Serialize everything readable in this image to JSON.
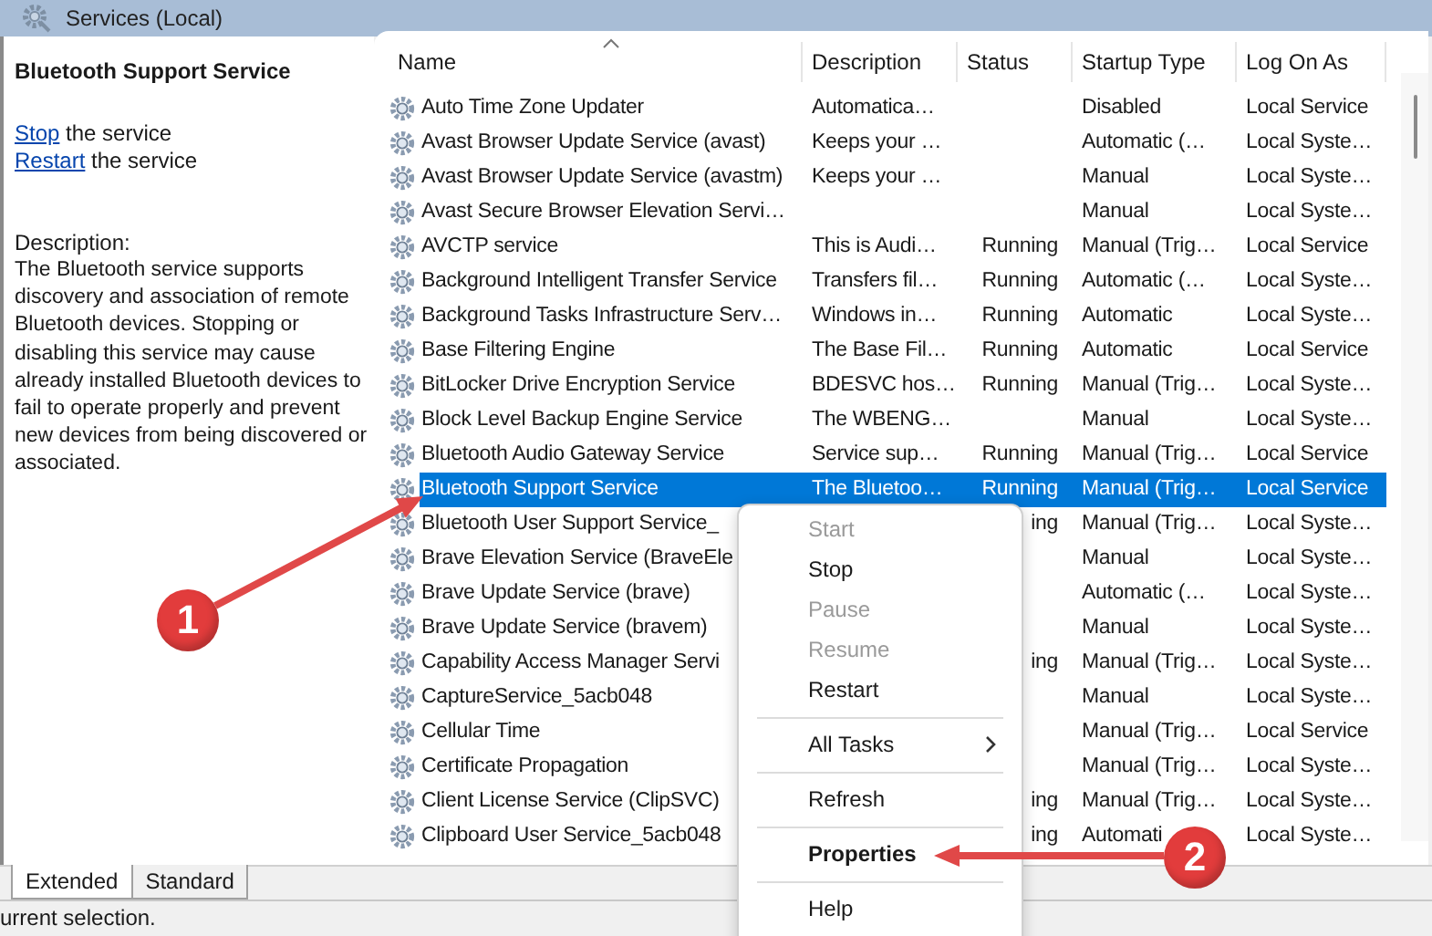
{
  "window": {
    "title": "Services (Local)"
  },
  "details": {
    "title": "Bluetooth Support Service",
    "actions": [
      {
        "link": "Stop",
        "text": "the service"
      },
      {
        "link": "Restart",
        "text": "the service"
      }
    ],
    "description_label": "Description:",
    "description": "The Bluetooth service supports discovery and association of remote Bluetooth devices.  Stopping or disabling this service may cause already installed Bluetooth devices to fail to operate properly and prevent new devices from being discovered or associated."
  },
  "table": {
    "columns": [
      "Name",
      "Description",
      "Status",
      "Startup Type",
      "Log On As"
    ],
    "rows": [
      {
        "name": "Auto Time Zone Updater",
        "description": "Automatica…",
        "startup_type": "Disabled",
        "log_on_as": "Local Service",
        "selected": false
      },
      {
        "name": "Avast Browser Update Service (avast)",
        "description": "Keeps your …",
        "startup_type": "Automatic (…",
        "log_on_as": "Local Syste…",
        "selected": false
      },
      {
        "name": "Avast Browser Update Service (avastm)",
        "description": "Keeps your …",
        "startup_type": "Manual",
        "log_on_as": "Local Syste…",
        "selected": false
      },
      {
        "name": "Avast Secure Browser Elevation Servi…",
        "startup_type": "Manual",
        "log_on_as": "Local Syste…",
        "selected": false
      },
      {
        "name": "AVCTP service",
        "description": "This is Audi…",
        "status": "Running",
        "startup_type": "Manual (Trig…",
        "log_on_as": "Local Service",
        "selected": false
      },
      {
        "name": "Background Intelligent Transfer Service",
        "description": "Transfers fil…",
        "status": "Running",
        "startup_type": "Automatic (…",
        "log_on_as": "Local Syste…",
        "selected": false
      },
      {
        "name": "Background Tasks Infrastructure Serv…",
        "description": "Windows in…",
        "status": "Running",
        "startup_type": "Automatic",
        "log_on_as": "Local Syste…",
        "selected": false
      },
      {
        "name": "Base Filtering Engine",
        "description": "The Base Fil…",
        "status": "Running",
        "startup_type": "Automatic",
        "log_on_as": "Local Service",
        "selected": false
      },
      {
        "name": "BitLocker Drive Encryption Service",
        "description": "BDESVC hos…",
        "status": "Running",
        "startup_type": "Manual (Trig…",
        "log_on_as": "Local Syste…",
        "selected": false
      },
      {
        "name": "Block Level Backup Engine Service",
        "description": "The WBENG…",
        "startup_type": "Manual",
        "log_on_as": "Local Syste…",
        "selected": false
      },
      {
        "name": "Bluetooth Audio Gateway Service",
        "description": "Service sup…",
        "status": "Running",
        "startup_type": "Manual (Trig…",
        "log_on_as": "Local Service",
        "selected": false
      },
      {
        "name": "Bluetooth Support Service",
        "description": "The Bluetoo…",
        "status": "Running",
        "startup_type": "Manual (Trig…",
        "log_on_as": "Local Service",
        "selected": true
      },
      {
        "name": "Bluetooth User Support Service_",
        "status": "ing",
        "startup_type": "Manual (Trig…",
        "log_on_as": "Local Syste…",
        "selected": false
      },
      {
        "name": "Brave Elevation Service (BraveEle",
        "startup_type": "Manual",
        "log_on_as": "Local Syste…",
        "selected": false
      },
      {
        "name": "Brave Update Service (brave)",
        "startup_type": "Automatic (…",
        "log_on_as": "Local Syste…",
        "selected": false
      },
      {
        "name": "Brave Update Service (bravem)",
        "startup_type": "Manual",
        "log_on_as": "Local Syste…",
        "selected": false
      },
      {
        "name": "Capability Access Manager Servi",
        "status": "ing",
        "startup_type": "Manual (Trig…",
        "log_on_as": "Local Syste…",
        "selected": false
      },
      {
        "name": "CaptureService_5acb048",
        "startup_type": "Manual",
        "log_on_as": "Local Syste…",
        "selected": false
      },
      {
        "name": "Cellular Time",
        "startup_type": "Manual (Trig…",
        "log_on_as": "Local Service",
        "selected": false
      },
      {
        "name": "Certificate Propagation",
        "startup_type": "Manual (Trig…",
        "log_on_as": "Local Syste…",
        "selected": false
      },
      {
        "name": "Client License Service (ClipSVC)",
        "status": "ing",
        "startup_type": "Manual (Trig…",
        "log_on_as": "Local Syste…",
        "selected": false
      },
      {
        "name": "Clipboard User Service_5acb048",
        "status": "ing",
        "startup_type": "Automati",
        "log_on_as": "Local Syste…",
        "selected": false
      }
    ]
  },
  "context_menu": [
    {
      "kind": "item",
      "label": "Start",
      "disabled": true
    },
    {
      "kind": "item",
      "label": "Stop",
      "disabled": false
    },
    {
      "kind": "item",
      "label": "Pause",
      "disabled": true
    },
    {
      "kind": "item",
      "label": "Resume",
      "disabled": true
    },
    {
      "kind": "item",
      "label": "Restart",
      "disabled": false
    },
    {
      "kind": "separator"
    },
    {
      "kind": "submenu",
      "label": "All Tasks",
      "disabled": false
    },
    {
      "kind": "separator"
    },
    {
      "kind": "item",
      "label": "Refresh",
      "disabled": false
    },
    {
      "kind": "separator"
    },
    {
      "kind": "default",
      "label": "Properties",
      "disabled": false
    },
    {
      "kind": "separator"
    },
    {
      "kind": "item",
      "label": "Help",
      "disabled": false
    }
  ],
  "view_tabs": [
    {
      "label": "Extended",
      "selected": true
    },
    {
      "label": "Standard",
      "selected": false
    }
  ],
  "status_bar": "urrent selection.",
  "annotations": [
    {
      "number": "1"
    },
    {
      "number": "2"
    }
  ]
}
